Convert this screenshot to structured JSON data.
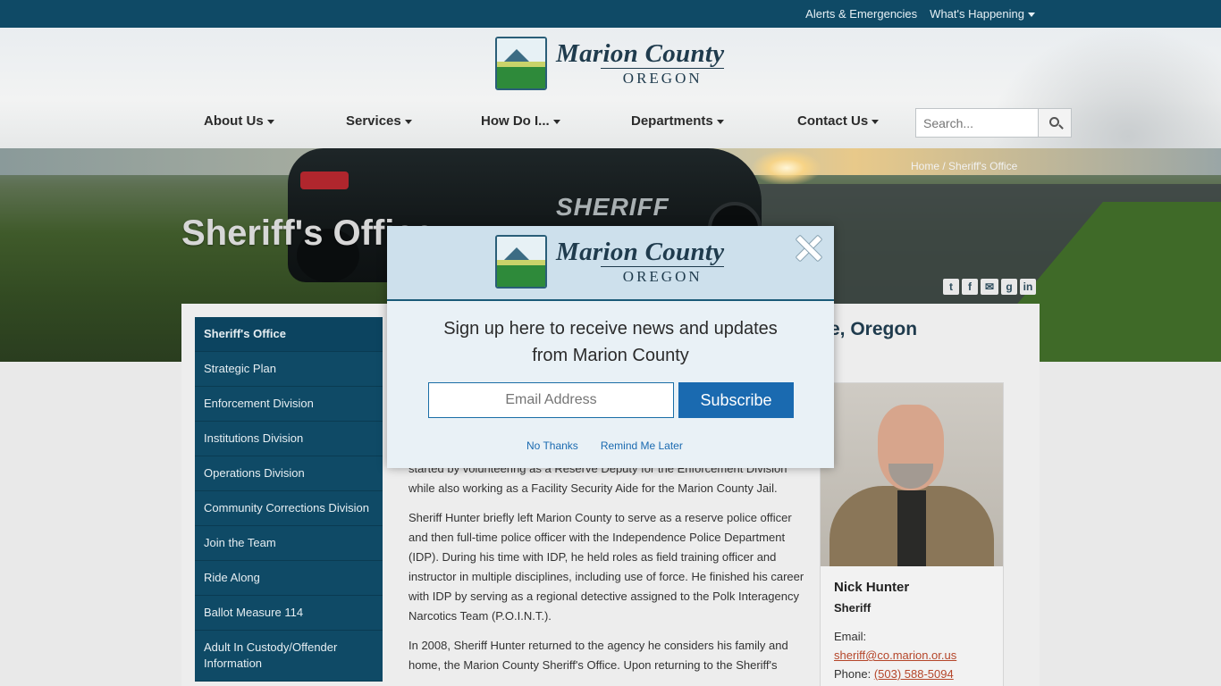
{
  "topbar": {
    "alerts": "Alerts & Emergencies",
    "whats_happening": "What's Happening"
  },
  "brand": {
    "name": "Marion County",
    "state": "OREGON"
  },
  "nav": {
    "items": [
      "About Us",
      "Services",
      "How Do I...",
      "Departments",
      "Contact Us"
    ],
    "search_placeholder": "Search..."
  },
  "breadcrumb": {
    "home": "Home",
    "separator": " / ",
    "current": "Sheriff's Office"
  },
  "hero": {
    "title": "Sheriff's Office",
    "car_text": "SHERIFF"
  },
  "social": [
    "twitter",
    "facebook",
    "email",
    "google-plus",
    "linkedin"
  ],
  "sidebar": {
    "items": [
      "Sheriff's Office",
      "Strategic Plan",
      "Enforcement Division",
      "Institutions Division",
      "Operations Division",
      "Community Corrections Division",
      "Join the Team",
      "Ride Along",
      "Ballot Measure 114",
      "Adult In Custody/Offender Information"
    ]
  },
  "content": {
    "heading_partial": "e, Oregon",
    "p1": "started by volunteering as a Reserve Deputy for the Enforcement Division while also working as a Facility Security Aide for the Marion County Jail.",
    "p2": "Sheriff Hunter briefly left Marion County to serve as a reserve police officer and then full-time police officer with the Independence Police Department (IDP).  During his time with IDP, he held roles as field training officer and instructor in multiple disciplines, including use of force. He finished his career with IDP by serving as a regional detective assigned to the Polk Interagency Narcotics Team (P.O.I.N.T.).",
    "p3": "In 2008, Sheriff Hunter returned to the agency he considers his family and home, the Marion County Sheriff's Office.  Upon returning to the Sheriff's"
  },
  "profile": {
    "name": "Nick Hunter",
    "role": "Sheriff",
    "email_label": "Email:",
    "email": "sheriff@co.marion.or.us",
    "phone_label": "Phone: ",
    "phone": "(503) 588-5094"
  },
  "modal": {
    "message": "Sign up here to receive news and updates from Marion County",
    "email_placeholder": "Email Address",
    "subscribe": "Subscribe",
    "no_thanks": "No Thanks",
    "remind_later": "Remind Me Later"
  },
  "colors": {
    "brand_dark": "#0f4a66",
    "subscribe_blue": "#1a6ab0",
    "link_orange": "#b5462a"
  }
}
